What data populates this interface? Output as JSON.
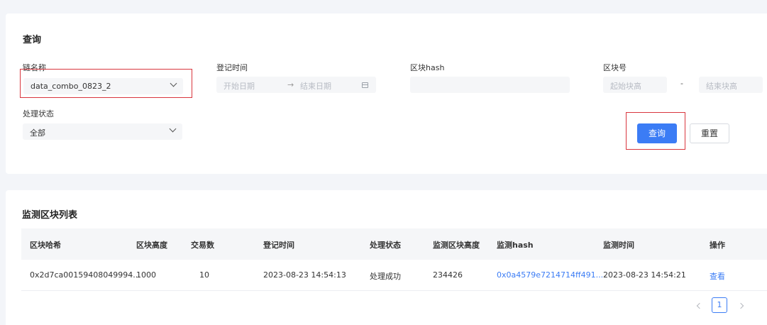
{
  "query": {
    "title": "查询",
    "chain_name": {
      "label": "链名称",
      "value": "data_combo_0823_2"
    },
    "register_time": {
      "label": "登记时间",
      "start_placeholder": "开始日期",
      "separator": "→",
      "end_placeholder": "结束日期"
    },
    "block_hash": {
      "label": "区块hash",
      "value": ""
    },
    "block_number": {
      "label": "区块号",
      "start_placeholder": "起始块高",
      "separator": "-",
      "end_placeholder": "结束块高"
    },
    "status": {
      "label": "处理状态",
      "value": "全部"
    },
    "search_label": "查询",
    "reset_label": "重置"
  },
  "list": {
    "title": "监测区块列表",
    "columns": [
      "区块哈希",
      "区块高度",
      "交易数",
      "登记时间",
      "处理状态",
      "监测区块高度",
      "监测hash",
      "监测时间",
      "操作"
    ],
    "rows": [
      {
        "block_hash": "0x2d7ca00159408049994...",
        "block_height": "1000",
        "tx_count": "10",
        "register_time": "2023-08-23 14:54:13",
        "status": "处理成功",
        "monitor_height": "234426",
        "monitor_hash": "0x0a4579e7214714ff491...",
        "monitor_time": "2023-08-23 14:54:21",
        "action": "查看"
      }
    ]
  },
  "pagination": {
    "current": "1"
  },
  "colors": {
    "primary": "#3b7cf5",
    "highlight": "#d9363e",
    "page_bg": "#f3f5f9"
  }
}
